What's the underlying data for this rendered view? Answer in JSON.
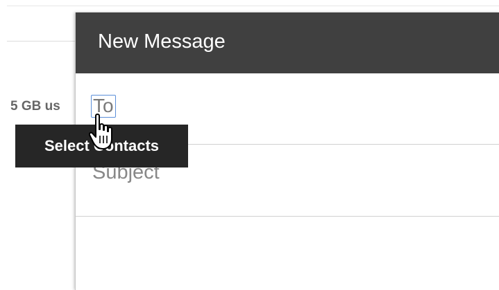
{
  "background": {
    "storage_text": "5 GB us"
  },
  "compose": {
    "title": "New Message",
    "to_label": "To",
    "subject_placeholder": "Subject",
    "header_color": "#404040"
  },
  "tooltip": {
    "text": "Select Contacts"
  },
  "cursor": {
    "icon": "hand-pointer-icon"
  }
}
